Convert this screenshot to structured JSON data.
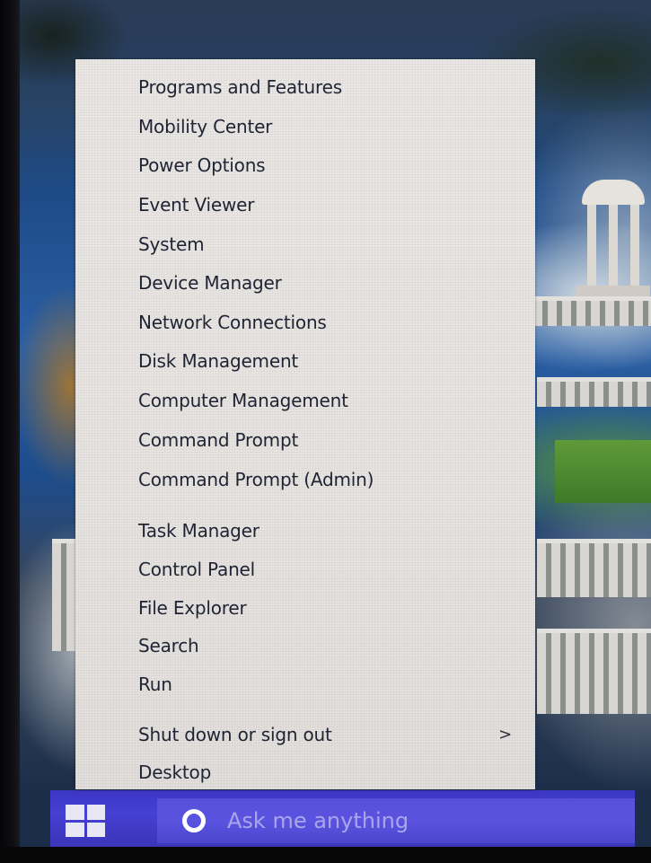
{
  "menu": {
    "items": [
      {
        "label": "Programs and Features"
      },
      {
        "label": "Mobility Center"
      },
      {
        "label": "Power Options"
      },
      {
        "label": "Event Viewer"
      },
      {
        "label": "System"
      },
      {
        "label": "Device Manager"
      },
      {
        "label": "Network Connections"
      },
      {
        "label": "Disk Management"
      },
      {
        "label": "Computer Management"
      },
      {
        "label": "Command Prompt"
      },
      {
        "label": "Command Prompt (Admin)"
      },
      {
        "label": "Task Manager"
      },
      {
        "label": "Control Panel"
      },
      {
        "label": "File Explorer"
      },
      {
        "label": "Search"
      },
      {
        "label": "Run"
      },
      {
        "label": "Shut down or sign out",
        "submenu_indicator": ">"
      },
      {
        "label": "Desktop"
      }
    ]
  },
  "taskbar": {
    "search_placeholder": "Ask me anything",
    "start_icon": "windows-logo-icon",
    "search_icon": "cortana-ring-icon"
  },
  "colors": {
    "taskbar": "#4640d4",
    "search_box": "#5a53e0",
    "menu_background": "#e8e5e2",
    "menu_text": "#1e2433"
  }
}
